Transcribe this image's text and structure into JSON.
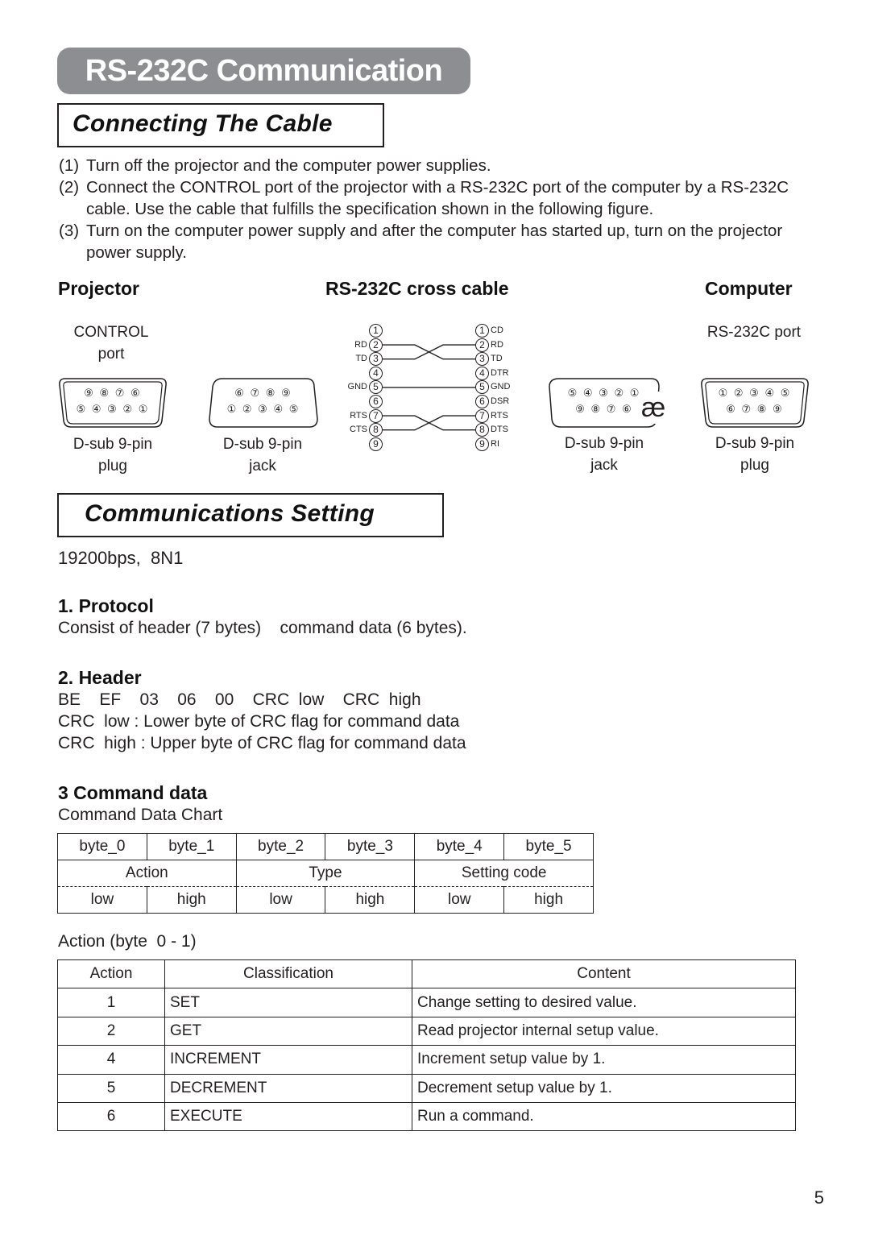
{
  "page_title": "RS-232C Communication",
  "sections": {
    "connecting": "Connecting The Cable",
    "settings": "Communications Setting"
  },
  "steps": [
    {
      "num": "(1)",
      "text": "Turn off the projector and the computer power supplies."
    },
    {
      "num": "(2)",
      "text": "Connect the CONTROL port of the projector with a RS-232C port of the computer by a RS-232C cable. Use the cable that fulfills the specification shown in the following figure."
    },
    {
      "num": "(3)",
      "text": "Turn on the computer power supply and after the computer has started up, turn on the projector power supply."
    }
  ],
  "diagram": {
    "projector_heading": "Projector",
    "cable_heading": "RS-232C cross cable",
    "computer_heading": "Computer",
    "projector_port_line1": "CONTROL",
    "projector_port_line2": "port",
    "computer_port": "RS-232C port",
    "connectors": [
      {
        "type": "D-sub 9-pin",
        "gender": "plug",
        "top_row": "⑨ ⑧ ⑦ ⑥",
        "bottom_row": "⑤ ④ ③ ② ①"
      },
      {
        "type": "D-sub 9-pin",
        "gender": "jack",
        "top_row": "⑥ ⑦ ⑧ ⑨",
        "bottom_row": "① ② ③ ④ ⑤"
      },
      {
        "type": "D-sub 9-pin",
        "gender": "jack",
        "top_row": "⑤ ④ ③ ② ①",
        "bottom_row": "⑨ ⑧ ⑦ ⑥"
      },
      {
        "type": "D-sub 9-pin",
        "gender": "plug",
        "top_row": "① ② ③ ④ ⑤",
        "bottom_row": "⑥ ⑦ ⑧ ⑨"
      }
    ],
    "arrow_glyph": "æ",
    "left_pins": [
      {
        "pin": "1",
        "signal": ""
      },
      {
        "pin": "2",
        "signal": "RD"
      },
      {
        "pin": "3",
        "signal": "TD"
      },
      {
        "pin": "4",
        "signal": ""
      },
      {
        "pin": "5",
        "signal": "GND"
      },
      {
        "pin": "6",
        "signal": ""
      },
      {
        "pin": "7",
        "signal": "RTS"
      },
      {
        "pin": "8",
        "signal": "CTS"
      },
      {
        "pin": "9",
        "signal": ""
      }
    ],
    "right_pins": [
      {
        "pin": "1",
        "signal": "CD"
      },
      {
        "pin": "2",
        "signal": "RD"
      },
      {
        "pin": "3",
        "signal": "TD"
      },
      {
        "pin": "4",
        "signal": "DTR"
      },
      {
        "pin": "5",
        "signal": "GND"
      },
      {
        "pin": "6",
        "signal": "DSR"
      },
      {
        "pin": "7",
        "signal": "RTS"
      },
      {
        "pin": "8",
        "signal": "DTS"
      },
      {
        "pin": "9",
        "signal": "RI"
      }
    ],
    "wiring": [
      {
        "from": 2,
        "to": 3
      },
      {
        "from": 3,
        "to": 2
      },
      {
        "from": 5,
        "to": 5
      },
      {
        "from": 7,
        "to": 8
      },
      {
        "from": 8,
        "to": 7
      }
    ]
  },
  "comm_setting": "19200bps,  8N1",
  "protocol": {
    "heading": "1. Protocol",
    "text": "Consist of header (7 bytes)    command data (6 bytes)."
  },
  "header": {
    "heading": "2. Header",
    "bytes_line": "BE    EF    03    06    00    CRC  low    CRC  high",
    "crc_low": "CRC  low : Lower byte of CRC flag for command data",
    "crc_high": "CRC  high : Upper byte of CRC flag for command data"
  },
  "command_data": {
    "heading": "3 Command data",
    "chart_title": "Command Data Chart",
    "bytes": [
      "byte_0",
      "byte_1",
      "byte_2",
      "byte_3",
      "byte_4",
      "byte_5"
    ],
    "groups": [
      "Action",
      "Type",
      "Setting code"
    ],
    "order": [
      "low",
      "high",
      "low",
      "high",
      "low",
      "high"
    ]
  },
  "action_table": {
    "caption": "Action (byte  0 - 1)",
    "headers": [
      "Action",
      "Classification",
      "Content"
    ],
    "rows": [
      [
        "1",
        "SET",
        "Change setting to desired value."
      ],
      [
        "2",
        "GET",
        "Read projector internal setup value."
      ],
      [
        "4",
        "INCREMENT",
        "Increment setup value by 1."
      ],
      [
        "5",
        "DECREMENT",
        "Decrement setup value by 1."
      ],
      [
        "6",
        "EXECUTE",
        "Run a command."
      ]
    ]
  },
  "page_number": "5"
}
